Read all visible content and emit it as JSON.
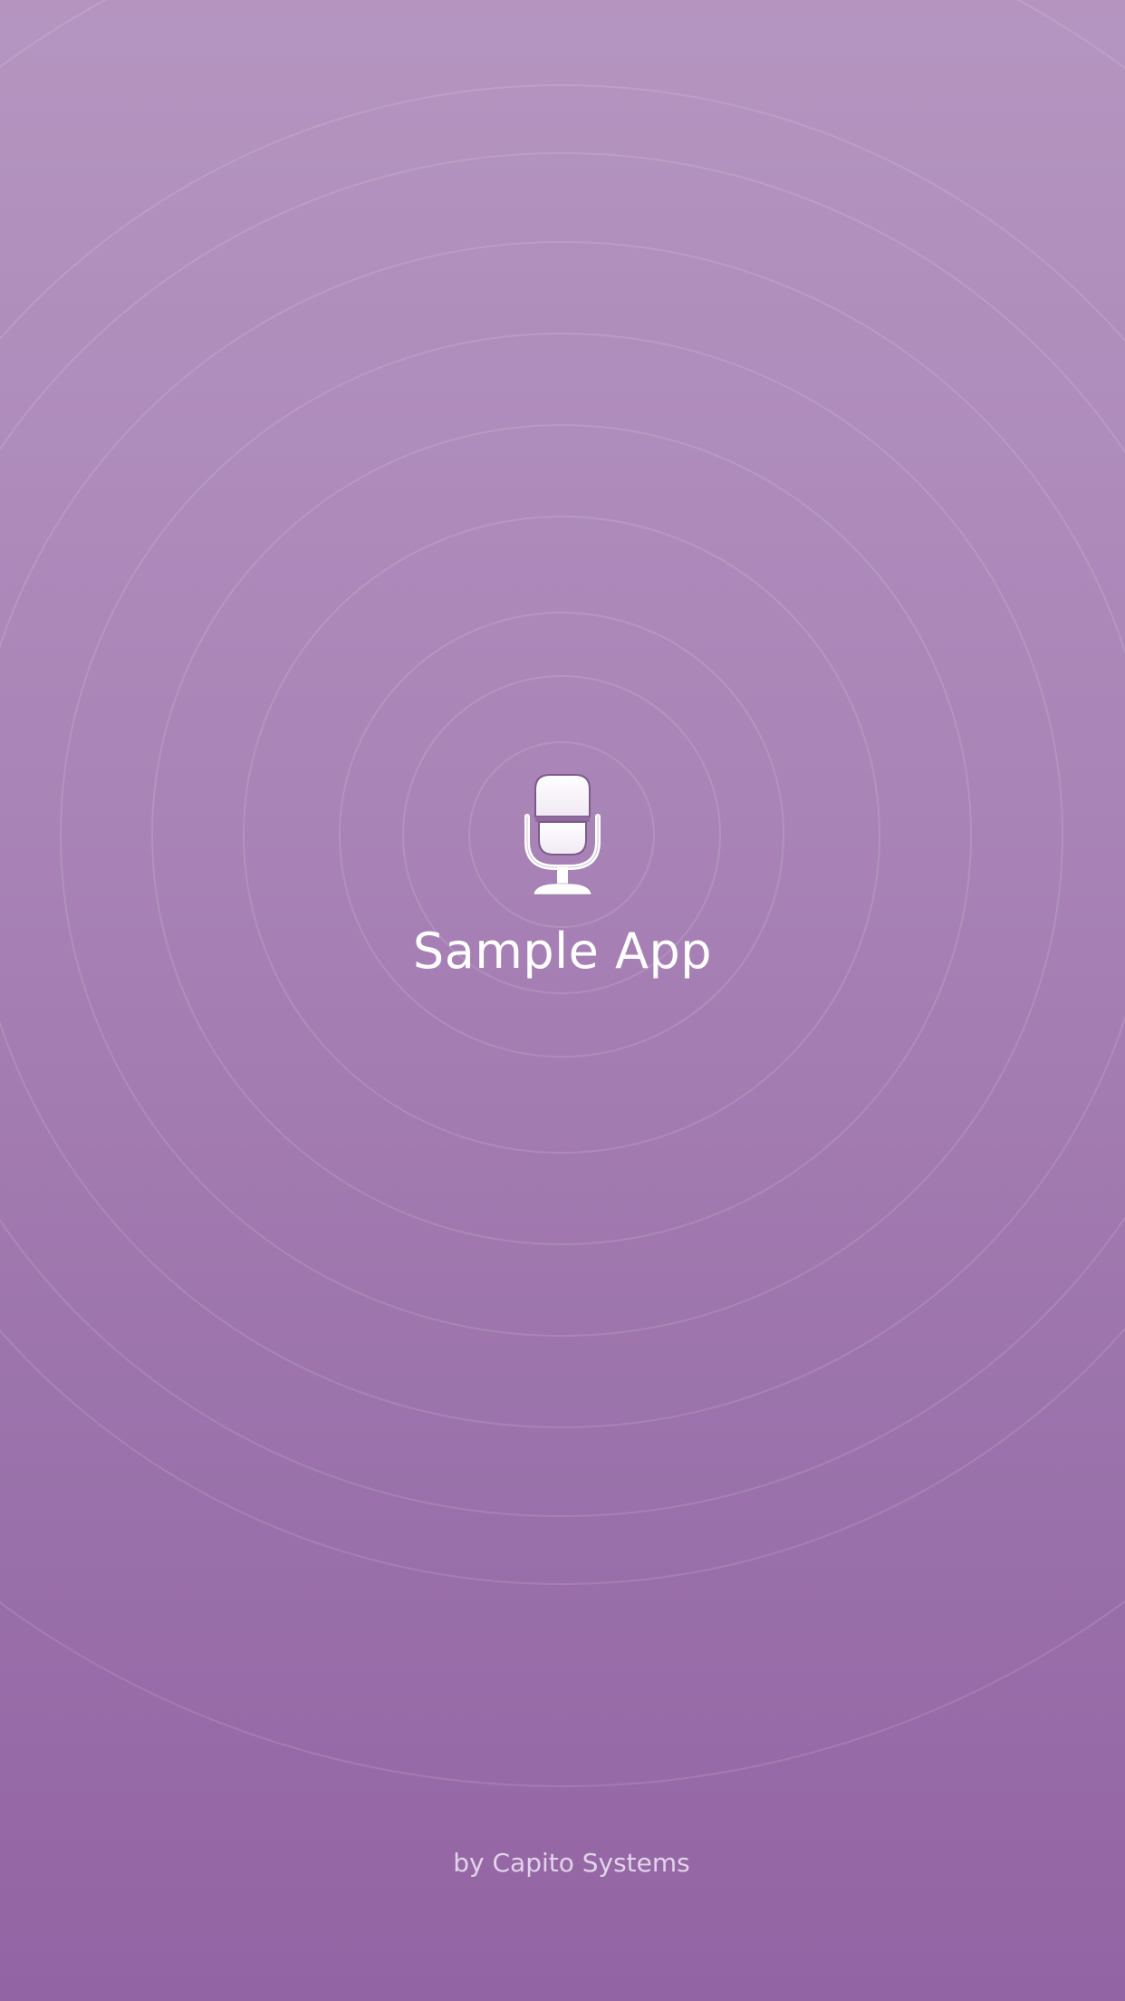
{
  "splash": {
    "app_name": "Sample App",
    "byline": "by Capito Systems",
    "icon": "microphone-icon"
  },
  "colors": {
    "background_top": "#b595c0",
    "background_bottom": "#9364a3",
    "text": "#ffffff",
    "byline_text": "#e2d3ea"
  }
}
